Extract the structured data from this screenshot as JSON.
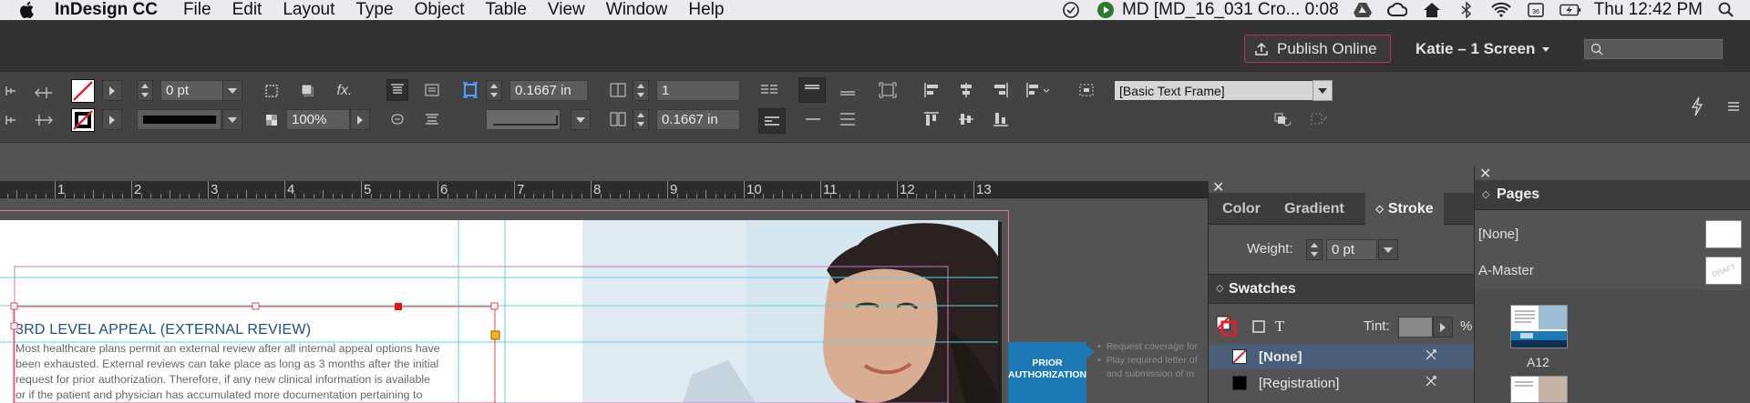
{
  "menubar": {
    "app_name": "InDesign CC",
    "items": [
      "File",
      "Edit",
      "Layout",
      "Type",
      "Object",
      "Table",
      "View",
      "Window",
      "Help"
    ],
    "status_text": "MD [MD_16_031 Cro... 0:08",
    "clock": "Thu 12:42 PM"
  },
  "appbar": {
    "publish_label": "Publish Online",
    "workspace_label": "Katie – 1 Screen"
  },
  "control": {
    "stroke_weight": "0 pt",
    "opacity": "100%",
    "inset": "0.1667 in",
    "columns": "1",
    "gutter": "0.1667 in",
    "frame_style": "[Basic Text Frame]"
  },
  "ruler": {
    "labels": [
      "1",
      "2",
      "3",
      "4",
      "5",
      "6",
      "7",
      "8",
      "9",
      "10",
      "11",
      "12",
      "13"
    ]
  },
  "document": {
    "heading": "3RD LEVEL APPEAL (EXTERNAL REVIEW)",
    "body_lines": [
      "Most healthcare plans permit an external review after all internal appeal options have",
      "been exhausted. External reviews can take place as long as 3 months after the initial",
      "request for prior authorization. Therefore, if any new clinical information is available",
      "or if the patient and physician has accumulated more documentation pertaining to"
    ],
    "prior_label_1": "PRIOR",
    "prior_label_2": "AUTHORIZATION",
    "bullet_1": "Request coverage for",
    "bullet_2": "Play required letter of",
    "bullet_3": "and submission of m"
  },
  "panel_stroke": {
    "tabs": [
      "Color",
      "Gradient",
      "Stroke"
    ],
    "weight_label": "Weight:",
    "weight_value": "0 pt",
    "swatches_title": "Swatches",
    "tint_label": "Tint:",
    "percent": "%",
    "swatch_rows": [
      "[None]",
      "[Registration]"
    ]
  },
  "panel_pages": {
    "title": "Pages",
    "none_label": "[None]",
    "master_label": "A-Master",
    "master_badge": "DRAFT",
    "page_label": "A12"
  },
  "colors": {
    "accent_blue": "#1d79b5",
    "heading_blue": "#1e4f82",
    "publish_border": "#b2364a",
    "selection": "#4a5e77"
  }
}
